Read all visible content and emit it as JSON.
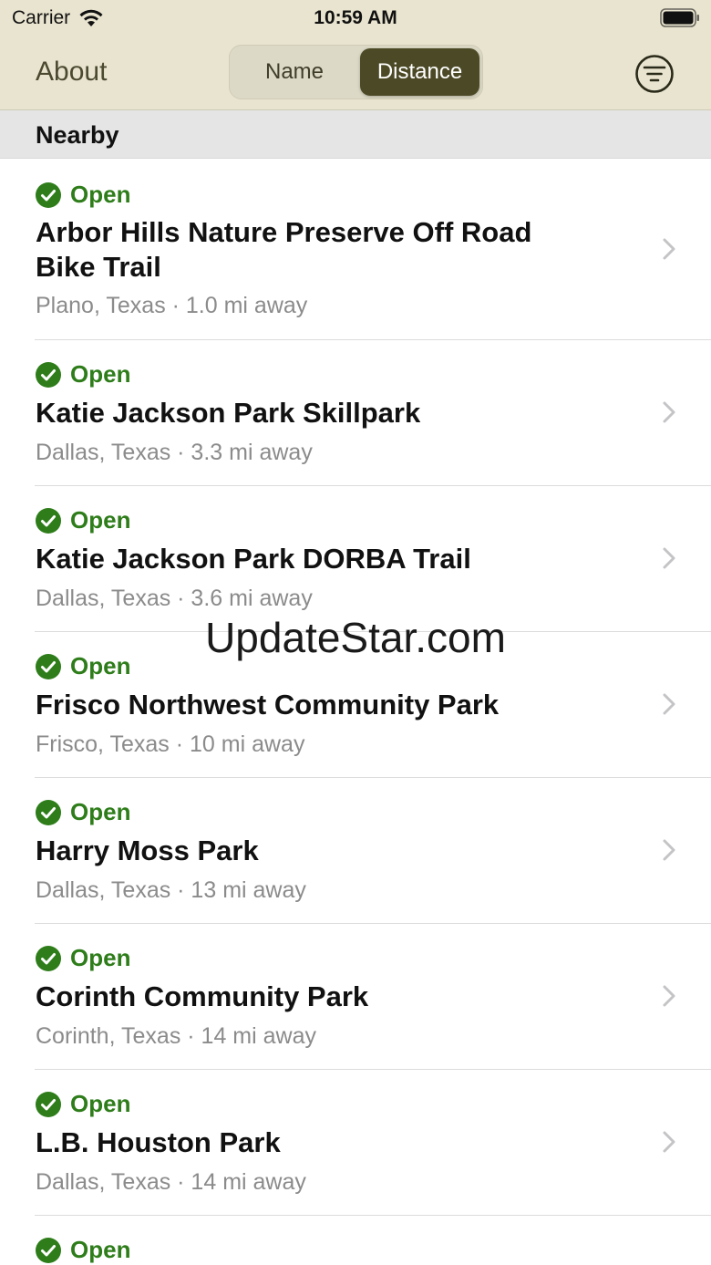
{
  "status_bar": {
    "carrier": "Carrier",
    "time": "10:59 AM"
  },
  "nav": {
    "about_label": "About",
    "segments": [
      "Name",
      "Distance"
    ],
    "selected_segment": "Distance",
    "filter_icon": "filter-icon"
  },
  "section_title": "Nearby",
  "trails": [
    {
      "status": "Open",
      "name": "Arbor Hills Nature Preserve Off Road Bike Trail",
      "location": "Plano, Texas · 1.0 mi away"
    },
    {
      "status": "Open",
      "name": "Katie Jackson Park Skillpark",
      "location": "Dallas, Texas · 3.3 mi away"
    },
    {
      "status": "Open",
      "name": "Katie Jackson Park DORBA Trail",
      "location": "Dallas, Texas · 3.6 mi away"
    },
    {
      "status": "Open",
      "name": "Frisco Northwest Community Park",
      "location": "Frisco, Texas · 10 mi away"
    },
    {
      "status": "Open",
      "name": "Harry Moss Park",
      "location": "Dallas, Texas · 13 mi away"
    },
    {
      "status": "Open",
      "name": "Corinth Community Park",
      "location": "Corinth, Texas · 14 mi away"
    },
    {
      "status": "Open",
      "name": "L.B. Houston Park",
      "location": "Dallas, Texas · 14 mi away"
    },
    {
      "status": "Open",
      "name": "",
      "location": ""
    }
  ],
  "watermark": "UpdateStar.com",
  "colors": {
    "header_bg": "#e9e4cf",
    "accent": "#4c4a26",
    "open_green": "#2e7d1a"
  }
}
